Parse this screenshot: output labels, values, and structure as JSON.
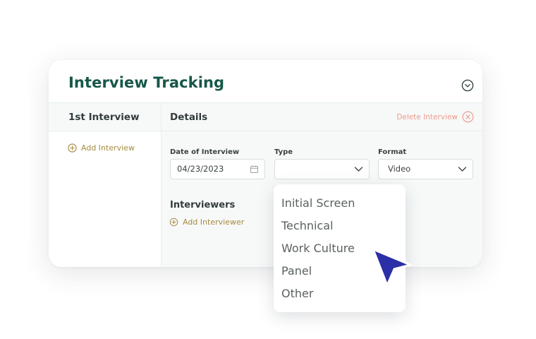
{
  "card": {
    "title": "Interview Tracking"
  },
  "left_pane": {
    "header": "1st Interview",
    "add_label": "Add Interview"
  },
  "details": {
    "header": "Details",
    "delete_label": "Delete Interview",
    "date_label": "Date of Interview",
    "date_value": "04/23/2023",
    "type_label": "Type",
    "type_value": "",
    "format_label": "Format",
    "format_value": "Video",
    "interviewers_title": "Interviewers",
    "add_interviewer_label": "Add Interviewer"
  },
  "type_dropdown": {
    "options": [
      "Initial Screen",
      "Technical",
      "Work Culture",
      "Panel",
      "Other"
    ]
  },
  "colors": {
    "title": "#17574a",
    "accent_gold": "#a58a3f",
    "delete": "#ee9a8c",
    "cursor": "#2b2fa8"
  },
  "icons": [
    "chevron-circle-icon",
    "plus-circle-icon",
    "close-circle-icon",
    "calendar-icon",
    "chevron-down-icon",
    "mouse-pointer-icon"
  ]
}
